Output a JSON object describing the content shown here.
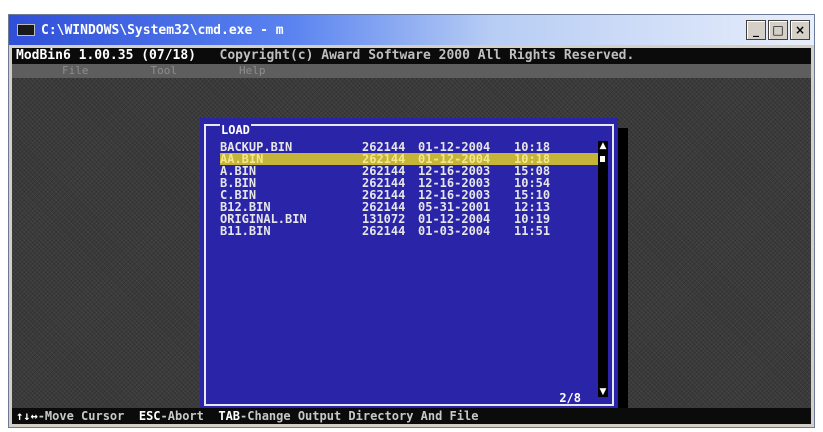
{
  "window": {
    "title": "C:\\WINDOWS\\System32\\cmd.exe - m",
    "buttons": {
      "minimize": "_",
      "maximize": "□",
      "close": "×"
    }
  },
  "app": {
    "header_name": "ModBin6 1.00.35 (07/18)",
    "header_copyright": "Copyright(c) Award Software 2000 All Rights Reserved."
  },
  "menu": [
    {
      "label": "File"
    },
    {
      "label": "Tool"
    },
    {
      "label": "Help"
    }
  ],
  "dialog": {
    "title": "LOAD",
    "page_indicator": "2/8",
    "selected_index": 1,
    "files": [
      {
        "name": "BACKUP.BIN",
        "size": "262144",
        "date": "01-12-2004",
        "time": "10:18"
      },
      {
        "name": "AA.BIN",
        "size": "262144",
        "date": "01-12-2004",
        "time": "10:18"
      },
      {
        "name": "A.BIN",
        "size": "262144",
        "date": "12-16-2003",
        "time": "15:08"
      },
      {
        "name": "B.BIN",
        "size": "262144",
        "date": "12-16-2003",
        "time": "10:54"
      },
      {
        "name": "C.BIN",
        "size": "262144",
        "date": "12-16-2003",
        "time": "15:10"
      },
      {
        "name": "B12.BIN",
        "size": "262144",
        "date": "05-31-2001",
        "time": "12:13"
      },
      {
        "name": "ORIGINAL.BIN",
        "size": "131072",
        "date": "01-12-2004",
        "time": "10:19"
      },
      {
        "name": "B11.BIN",
        "size": "262144",
        "date": "01-03-2004",
        "time": "11:51"
      }
    ]
  },
  "status": [
    {
      "key": "↑↓↔",
      "text": "-Move Cursor"
    },
    {
      "key": "ESC",
      "text": "-Abort"
    },
    {
      "key": "TAB",
      "text": "-Change Output Directory And File"
    }
  ],
  "colors": {
    "dialog_bg": "#2a24a8",
    "selection": "#c4b43a",
    "console_bg": "#3a3a3a"
  }
}
